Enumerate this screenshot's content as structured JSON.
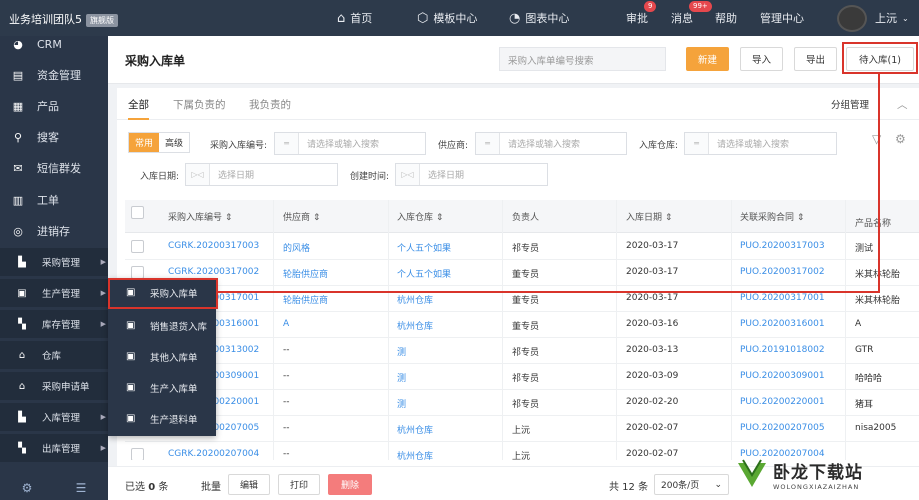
{
  "topbar": {
    "team": "业务培训团队5",
    "badge": "旗舰版",
    "nav": [
      {
        "label": "首页",
        "icon": "home-icon",
        "glyph": "⌂"
      },
      {
        "label": "模板中心",
        "icon": "cube-icon",
        "glyph": "⬡"
      },
      {
        "label": "图表中心",
        "icon": "pie-chart-icon",
        "glyph": "◔"
      },
      {
        "label": "审批",
        "badge": "9"
      },
      {
        "label": "消息",
        "badge": "99+"
      },
      {
        "label": "帮助"
      },
      {
        "label": "管理中心"
      }
    ],
    "user": "上沅",
    "user_caret": "⌄"
  },
  "sidebar": {
    "items": [
      {
        "label": "CRM",
        "glyph": "◕"
      },
      {
        "label": "资金管理",
        "glyph": "▤"
      },
      {
        "label": "产品",
        "glyph": "▦"
      },
      {
        "label": "搜客",
        "glyph": "⚲"
      },
      {
        "label": "短信群发",
        "glyph": "✉"
      },
      {
        "label": "工单",
        "glyph": "▥"
      },
      {
        "label": "进销存",
        "glyph": "◎"
      }
    ],
    "sub_items": [
      {
        "label": "采购管理",
        "glyph": "▙",
        "arrow": "▶"
      },
      {
        "label": "生产管理",
        "glyph": "▣",
        "arrow": "▶"
      },
      {
        "label": "库存管理",
        "glyph": "▚",
        "arrow": "▶"
      },
      {
        "label": "仓库",
        "glyph": "⌂",
        "arrow": ""
      },
      {
        "label": "采购申请单",
        "glyph": "⌂",
        "arrow": ""
      },
      {
        "label": "入库管理",
        "glyph": "▙",
        "arrow": "▶"
      },
      {
        "label": "出库管理",
        "glyph": "▚",
        "arrow": "▶"
      }
    ],
    "footer_icons": [
      "⚙",
      "☰"
    ]
  },
  "popup_menu": [
    {
      "label": "采购入库单",
      "glyph": "▣"
    },
    {
      "label": "销售退货入库",
      "glyph": "▣"
    },
    {
      "label": "其他入库单",
      "glyph": "▣"
    },
    {
      "label": "生产入库单",
      "glyph": "▣"
    },
    {
      "label": "生产退料单",
      "glyph": "▣"
    }
  ],
  "header": {
    "title": "采购入库单",
    "search_placeholder": "采购入库单编号搜索",
    "buttons": {
      "new": "新建",
      "import": "导入",
      "export": "导出",
      "pending": "待入库(1)"
    }
  },
  "tabs": [
    "全部",
    "下属负责的",
    "我负责的"
  ],
  "group_manage": "分组管理",
  "filters": {
    "mode_common": "常用",
    "mode_advanced": "高级",
    "op_eq": "═",
    "op_range": "▷◁",
    "order_no_label": "采购入库编号:",
    "supplier_label": "供应商:",
    "warehouse_label": "入库仓库:",
    "select_placeholder": "请选择或输入搜索",
    "in_date_label": "入库日期:",
    "created_label": "创建时间:",
    "date_placeholder": "选择日期"
  },
  "table": {
    "columns": [
      "采购入库编号",
      "供应商",
      "入库仓库",
      "负责人",
      "入库日期",
      "关联采购合同",
      "产品名称"
    ],
    "sort_glyph": "⇕",
    "rows": [
      {
        "code": "CGRK.20200317003",
        "supplier": "的风格",
        "warehouse": "个人五个如果",
        "owner": "祁专员",
        "date": "2020-03-17",
        "contract": "PUO.20200317003",
        "product": "测试"
      },
      {
        "code": "CGRK.20200317002",
        "supplier": "轮胎供应商",
        "warehouse": "个人五个如果",
        "owner": "董专员",
        "date": "2020-03-17",
        "contract": "PUO.20200317002",
        "product": "米其林轮胎"
      },
      {
        "code": "CGRK.20200317001",
        "supplier": "轮胎供应商",
        "warehouse": "杭州仓库",
        "owner": "董专员",
        "date": "2020-03-17",
        "contract": "PUO.20200317001",
        "product": "米其林轮胎"
      },
      {
        "code": "CGRK.20200316001",
        "supplier": "A",
        "warehouse": "杭州仓库",
        "owner": "董专员",
        "date": "2020-03-16",
        "contract": "PUO.20200316001",
        "product": "A"
      },
      {
        "code": "CGRK.20200313002",
        "supplier": "--",
        "warehouse": "测",
        "owner": "祁专员",
        "date": "2020-03-13",
        "contract": "PUO.20191018002",
        "product": "GTR"
      },
      {
        "code": "CGRK.20200309001",
        "supplier": "--",
        "warehouse": "测",
        "owner": "祁专员",
        "date": "2020-03-09",
        "contract": "PUO.20200309001",
        "product": "哈哈哈"
      },
      {
        "code": "CGRK.20200220001",
        "supplier": "--",
        "warehouse": "测",
        "owner": "祁专员",
        "date": "2020-02-20",
        "contract": "PUO.20200220001",
        "product": "猪耳"
      },
      {
        "code": "CGRK.20200207005",
        "supplier": "--",
        "warehouse": "杭州仓库",
        "owner": "上沅",
        "date": "2020-02-07",
        "contract": "PUO.20200207005",
        "product": "nisa2005"
      },
      {
        "code": "CGRK.20200207004",
        "supplier": "--",
        "warehouse": "杭州仓库",
        "owner": "上沅",
        "date": "2020-02-07",
        "contract": "PUO.20200207004",
        "product": ""
      }
    ]
  },
  "footer": {
    "selected_prefix": "已选",
    "selected_count": "0",
    "selected_suffix": "条",
    "bulk": "批量",
    "edit": "编辑",
    "print": "打印",
    "delete": "删除",
    "total": "共 12 条",
    "page_size": "200条/页",
    "page_caret": "⌄"
  },
  "watermark": {
    "title": "卧龙下载站",
    "sub": "WOLONGXIAZAIZHAN"
  },
  "colors": {
    "accent": "#f5a33b",
    "link": "#3a8ee6",
    "highlight": "#d9342b",
    "sidebar": "#2a3648"
  }
}
